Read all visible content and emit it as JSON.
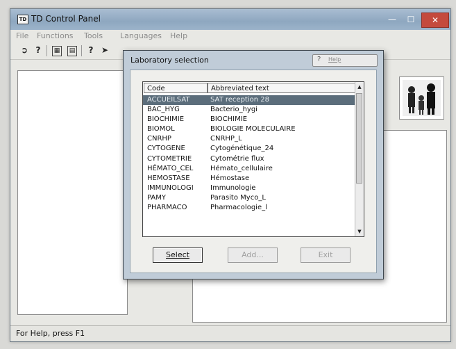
{
  "window": {
    "title": "TD Control Panel",
    "icon_text": "TD"
  },
  "menu": [
    "File",
    "Functions",
    "Tools",
    "Languages",
    "Help"
  ],
  "status": {
    "text": "For Help, press F1"
  },
  "dialog": {
    "title": "Laboratory selection",
    "help_label": "Help",
    "columns": {
      "code": "Code",
      "text": "Abbreviated text"
    },
    "rows": [
      {
        "code": "ACCUEILSAT",
        "text": "SAT reception 28",
        "selected": true
      },
      {
        "code": "BAC_HYG",
        "text": "Bacterio_hygi"
      },
      {
        "code": "BIOCHIMIE",
        "text": "BIOCHIMIE"
      },
      {
        "code": "BIOMOL",
        "text": "BIOLOGIE MOLECULAIRE"
      },
      {
        "code": "CNRHP",
        "text": "CNRHP_L"
      },
      {
        "code": "CYTOGENE",
        "text": "Cytogénétique_24"
      },
      {
        "code": "CYTOMETRIE",
        "text": "Cytométrie flux"
      },
      {
        "code": "HÉMATO_CEL",
        "text": "Hémato_cellulaire"
      },
      {
        "code": "HEMOSTASE",
        "text": "Hémostase"
      },
      {
        "code": "IMMUNOLOGI",
        "text": "Immunologie"
      },
      {
        "code": "PAMY",
        "text": "Parasito Myco_L"
      },
      {
        "code": "PHARMACO",
        "text": "Pharmacologie_l"
      }
    ],
    "buttons": {
      "select": "Select",
      "add": "Add...",
      "exit": "Exit"
    }
  },
  "colors": {
    "selection": "#5b6d7b",
    "dialog_frame": "#c0ccd8",
    "titlebar": "#9cb3ca",
    "close_button": "#c44a3d"
  }
}
